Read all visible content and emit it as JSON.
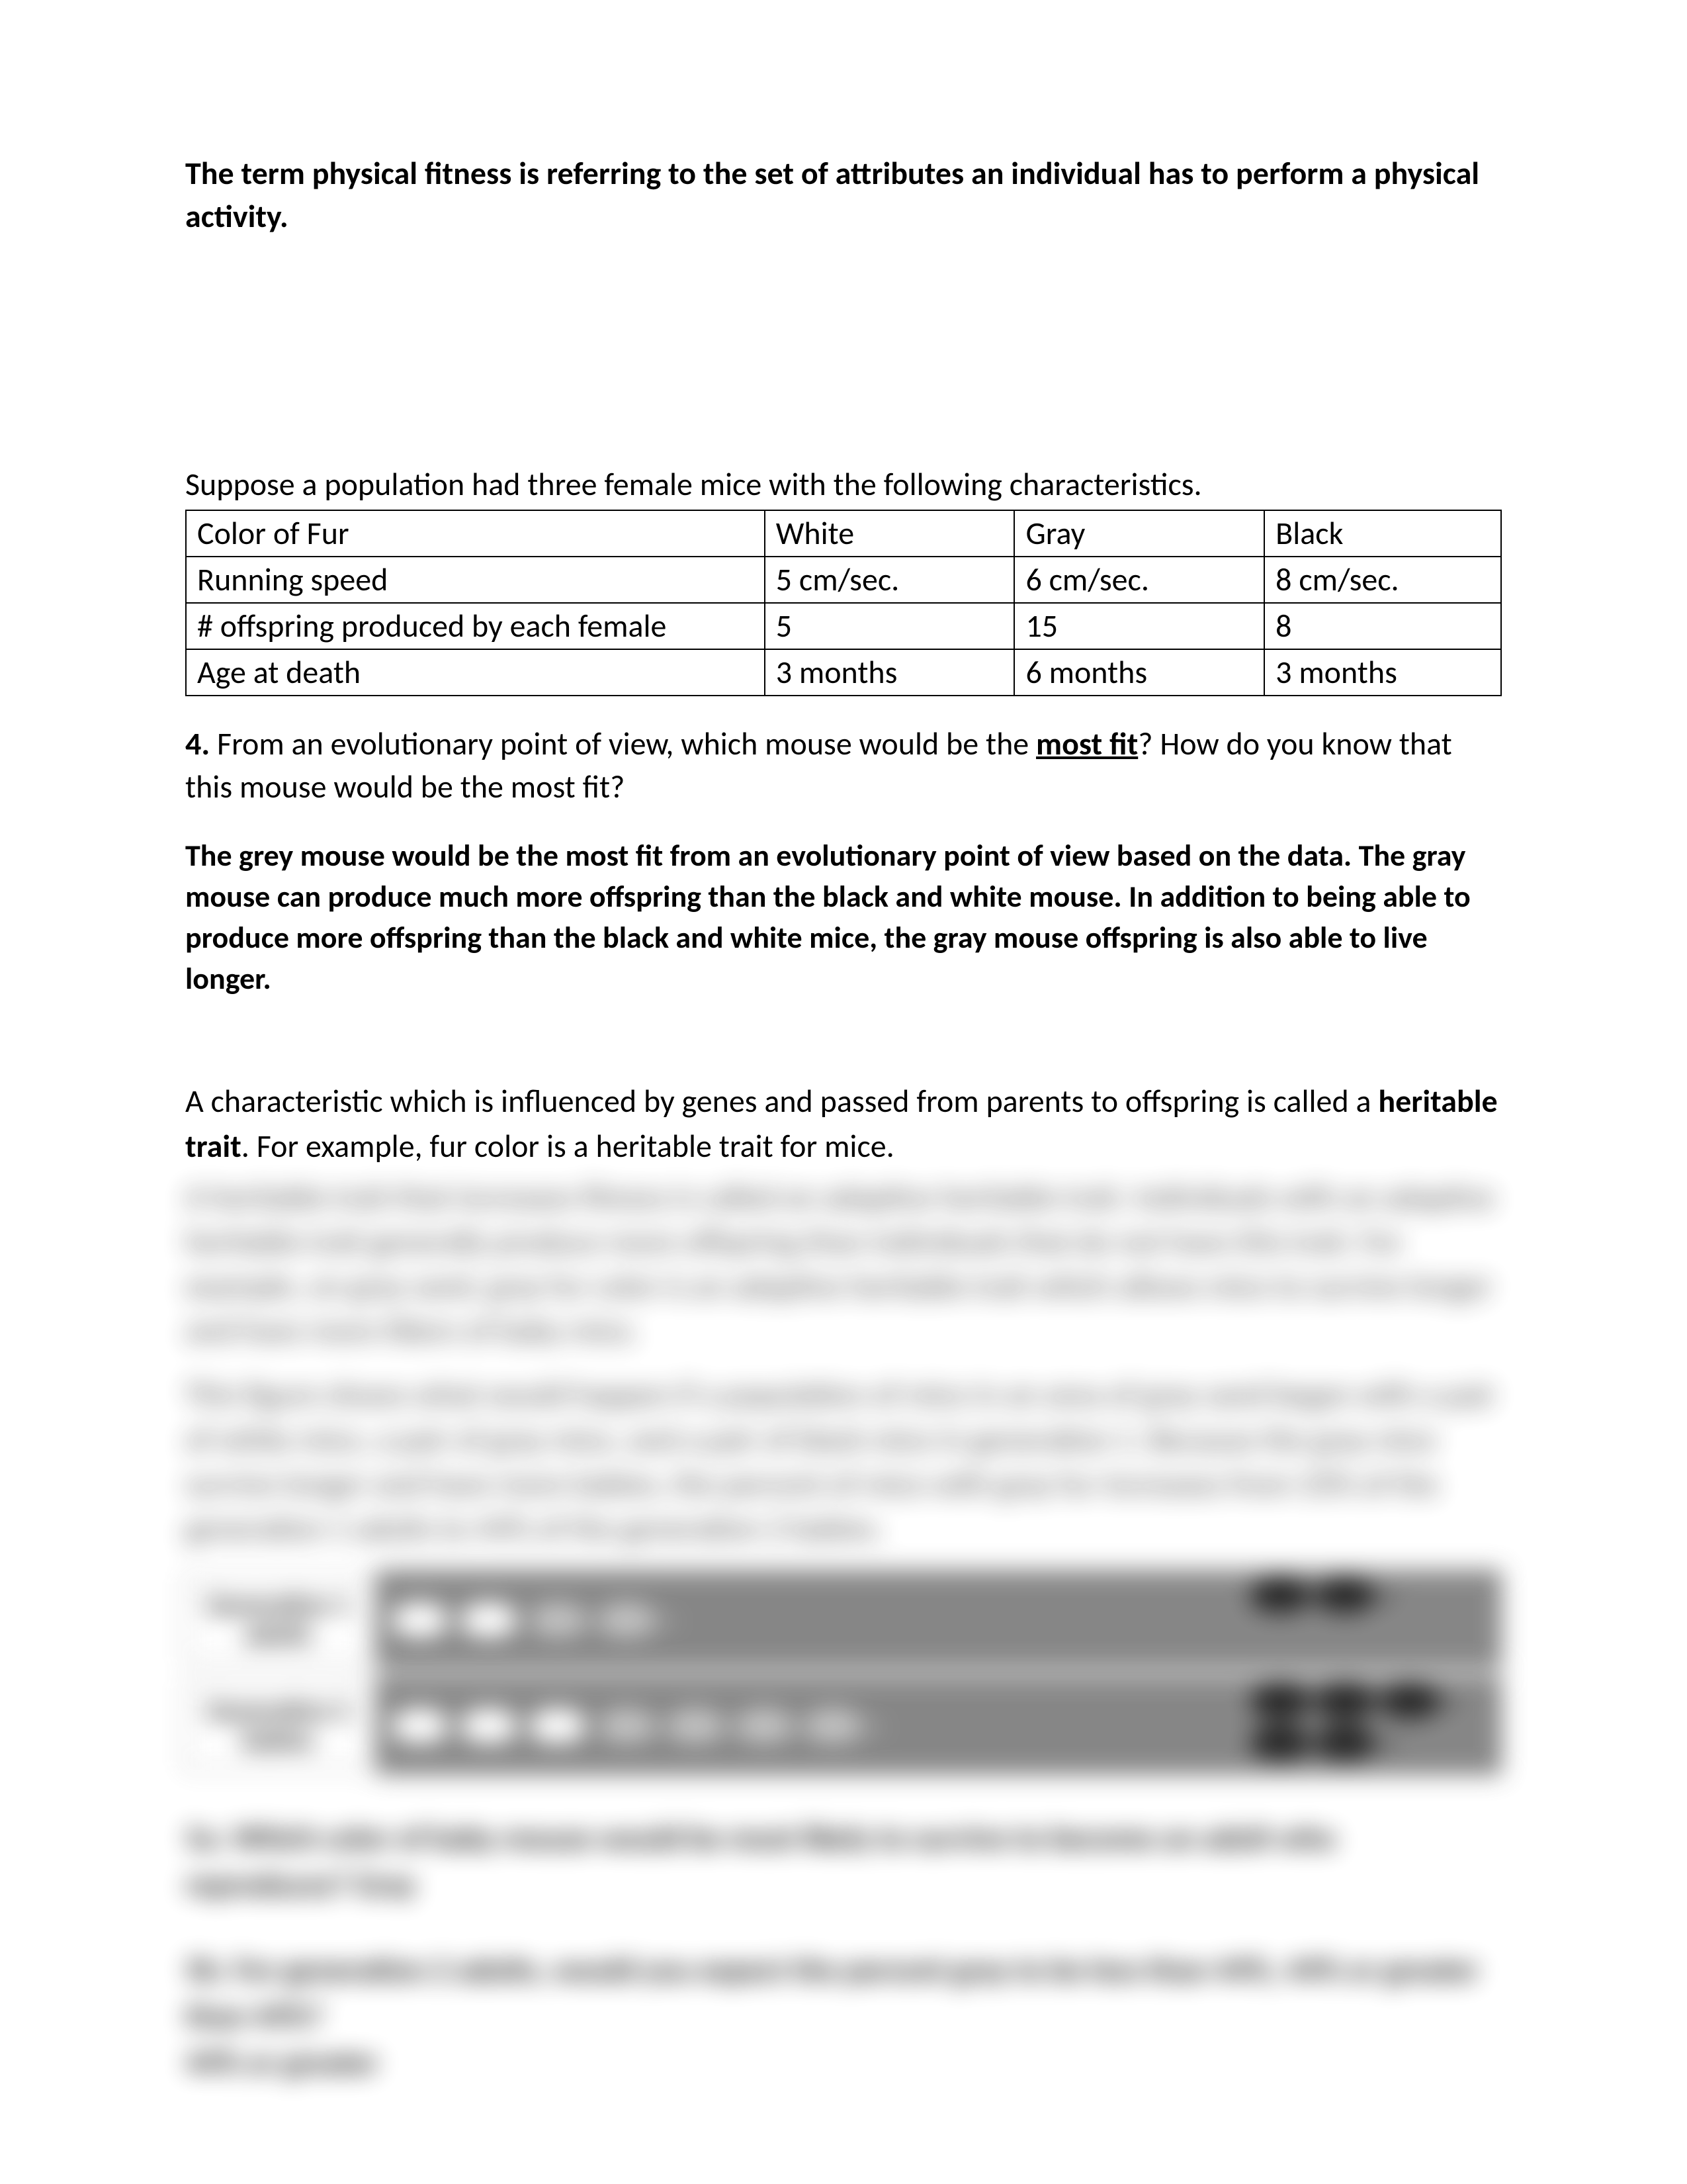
{
  "intro": "The term physical fitness is referring to the set of attributes an individual has to perform a physical activity.",
  "suppose": "Suppose a population had three female mice with the following characteristics.",
  "table": {
    "rows": [
      {
        "label": "Color of Fur",
        "a": "White",
        "b": "Gray",
        "c": "Black"
      },
      {
        "label": "Running speed",
        "a": "5 cm/sec.",
        "b": "6 cm/sec.",
        "c": "8 cm/sec."
      },
      {
        "label": "# offspring produced by each female",
        "a": "5",
        "b": "15",
        "c": "8"
      },
      {
        "label": "Age at death",
        "a": "3 months",
        "b": "6 months",
        "c": "3 months"
      }
    ]
  },
  "q4": {
    "num": "4.",
    "lead": " From an evolutionary point of view, which mouse would be the ",
    "mostfit": "most fit",
    "tail": "? How do you know that this mouse would be the most fit?"
  },
  "answer4": "The grey mouse would be the most fit from an evolutionary point of view based on the data. The gray mouse can produce much more offspring than the black and white mouse. In addition to being able to produce more offspring than the black and white mice, the gray mouse offspring is also able to live longer.",
  "heritable": {
    "line1": "A characteristic which is influenced by genes and passed from parents to offspring is called a ",
    "bold": "heritable trait",
    "line2": ". For example, fur color is a heritable trait for mice."
  },
  "blurred": {
    "p1": "A heritable trait that increases fitness is called an adaptive heritable trait. Individuals with an adaptive heritable trait generally produce more offspring than individuals that do not have this trait. For example, on gray sand, gray fur color is an adaptive heritable trait which allows mice to survive longer and have more litters of baby mice.",
    "p2": "This figure shows what would happen if a population of mice in an area of gray sand began with a pair of white mice, a pair of gray mice, and a pair of black mice in generation 1. Because the gray mice survive longer and have more babies, the percent of mice with gray fur increases from 33% of the generation 1 adults to 44% of the generation 2 babies.",
    "gen1": "Generation 1 adults",
    "gen2": "Generation 2 babies",
    "q5a": "5a. Which color of baby mouse would be most likely to survive to become an adult who reproduces?  Gray",
    "q5b": "5b. For generation 2 adults, would you expect the percent gray to be less than 44%, 44% or greater than 44%?",
    "q5b_ans": "44% or greater"
  }
}
